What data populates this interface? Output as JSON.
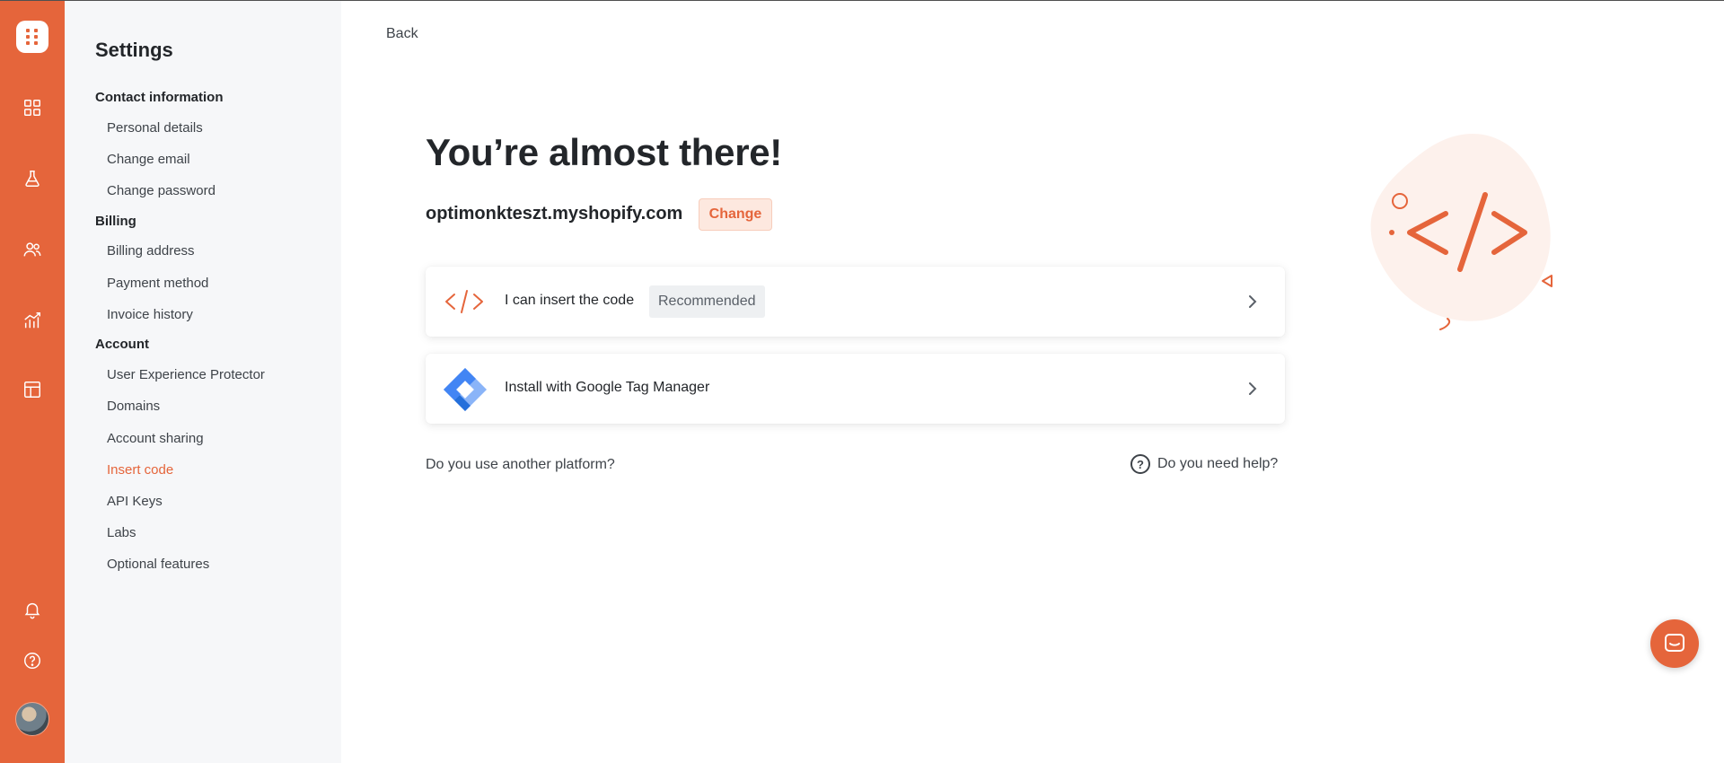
{
  "colors": {
    "accent": "#e5653b",
    "sidebar_bg": "#f6f7f9"
  },
  "rail": {
    "icons": [
      "logo-icon",
      "dashboard-icon",
      "experiments-icon",
      "users-icon",
      "analytics-icon",
      "templates-icon",
      "bell-icon",
      "help-icon",
      "avatar"
    ]
  },
  "sidebar": {
    "title": "Settings",
    "sections": [
      {
        "label": "Contact information",
        "items": [
          "Personal details",
          "Change email",
          "Change password"
        ]
      },
      {
        "label": "Billing",
        "items": [
          "Billing address",
          "Payment method",
          "Invoice history"
        ]
      },
      {
        "label": "Account",
        "items": [
          "User Experience Protector",
          "Domains",
          "Account sharing",
          "Insert code",
          "API Keys",
          "Labs",
          "Optional features"
        ]
      }
    ],
    "active_item": "Insert code"
  },
  "main": {
    "back_label": "Back",
    "title": "You’re almost there!",
    "domain": "optimonkteszt.myshopify.com",
    "change_label": "Change",
    "options": [
      {
        "icon": "code-icon",
        "label": "I can insert the code",
        "badge": "Recommended"
      },
      {
        "icon": "google-tag-manager-icon",
        "label": "Install with Google Tag Manager",
        "badge": ""
      }
    ],
    "other_platform_label": "Do you use another platform?",
    "help_label": "Do you need help?"
  },
  "chat": {
    "icon": "chat-icon"
  }
}
